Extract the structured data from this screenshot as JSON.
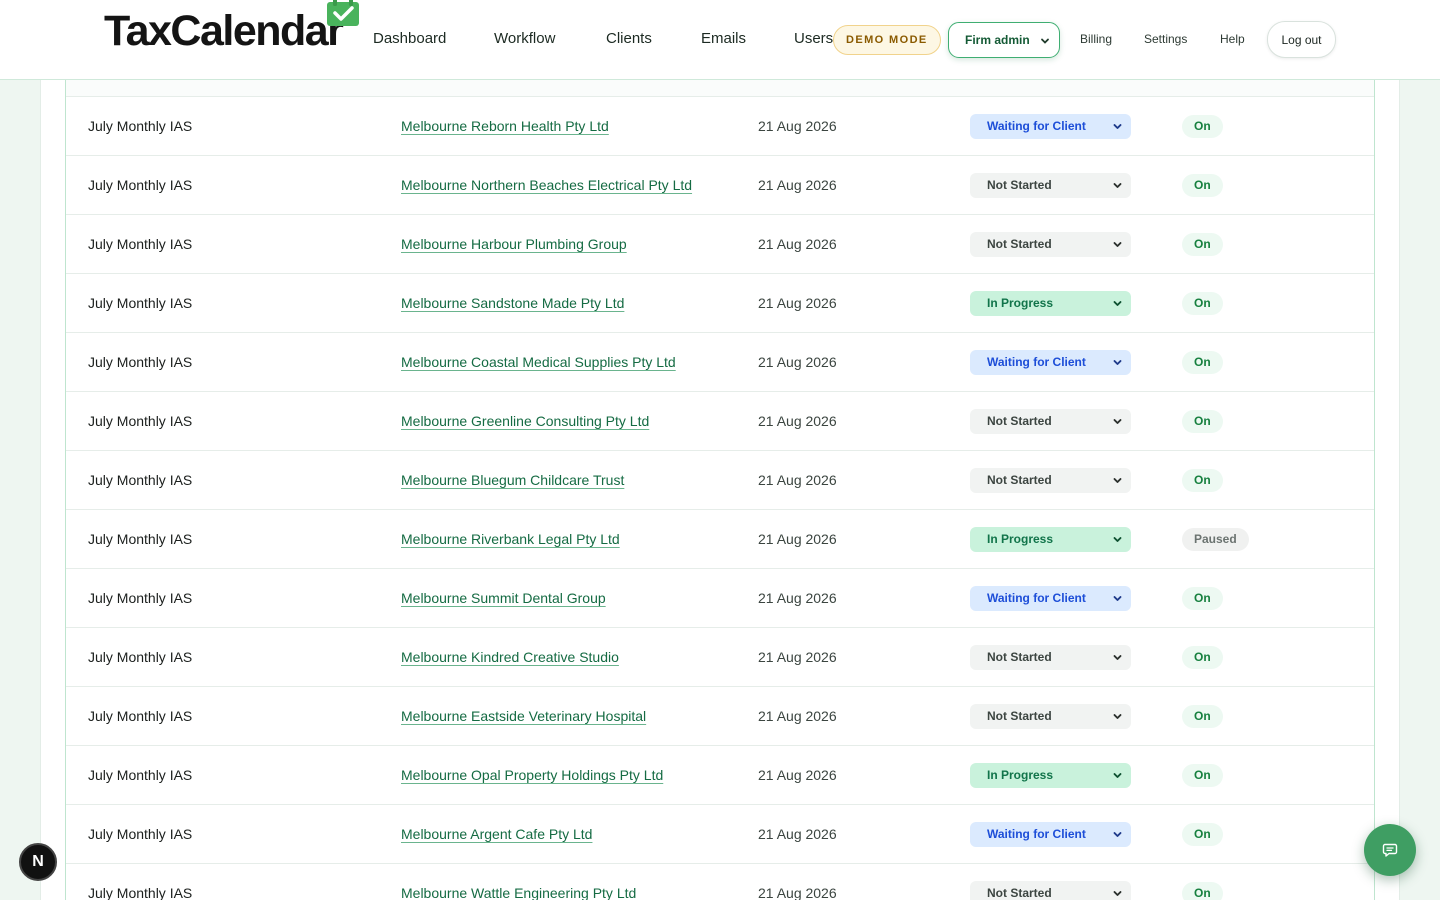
{
  "brand": {
    "logo_text": "TaxCalendar"
  },
  "nav": {
    "links": [
      "Dashboard",
      "Workflow",
      "Clients",
      "Emails",
      "Users"
    ],
    "demo_badge": "DEMO MODE",
    "role_select": "Firm admin",
    "billing": "Billing",
    "settings": "Settings",
    "help": "Help",
    "logout": "Log out"
  },
  "colors": {
    "accent": "#3f9e63",
    "link": "#156b43",
    "status_waiting": "#dbeafe",
    "status_in_progress": "#c9f2dc",
    "status_not_started": "#f1f3f2"
  },
  "rows": [
    {
      "task": "July Monthly IAS",
      "client": "Melbourne Reborn Health Pty Ltd",
      "due": "21 Aug 2026",
      "status": "Waiting for Client",
      "reminders": "On"
    },
    {
      "task": "July Monthly IAS",
      "client": "Melbourne Northern Beaches Electrical Pty Ltd",
      "due": "21 Aug 2026",
      "status": "Not Started",
      "reminders": "On"
    },
    {
      "task": "July Monthly IAS",
      "client": "Melbourne Harbour Plumbing Group",
      "due": "21 Aug 2026",
      "status": "Not Started",
      "reminders": "On"
    },
    {
      "task": "July Monthly IAS",
      "client": "Melbourne Sandstone Made Pty Ltd",
      "due": "21 Aug 2026",
      "status": "In Progress",
      "reminders": "On"
    },
    {
      "task": "July Monthly IAS",
      "client": "Melbourne Coastal Medical Supplies Pty Ltd",
      "due": "21 Aug 2026",
      "status": "Waiting for Client",
      "reminders": "On"
    },
    {
      "task": "July Monthly IAS",
      "client": "Melbourne Greenline Consulting Pty Ltd",
      "due": "21 Aug 2026",
      "status": "Not Started",
      "reminders": "On"
    },
    {
      "task": "July Monthly IAS",
      "client": "Melbourne Bluegum Childcare Trust",
      "due": "21 Aug 2026",
      "status": "Not Started",
      "reminders": "On"
    },
    {
      "task": "July Monthly IAS",
      "client": "Melbourne Riverbank Legal Pty Ltd",
      "due": "21 Aug 2026",
      "status": "In Progress",
      "reminders": "Paused"
    },
    {
      "task": "July Monthly IAS",
      "client": "Melbourne Summit Dental Group",
      "due": "21 Aug 2026",
      "status": "Waiting for Client",
      "reminders": "On"
    },
    {
      "task": "July Monthly IAS",
      "client": "Melbourne Kindred Creative Studio",
      "due": "21 Aug 2026",
      "status": "Not Started",
      "reminders": "On"
    },
    {
      "task": "July Monthly IAS",
      "client": "Melbourne Eastside Veterinary Hospital",
      "due": "21 Aug 2026",
      "status": "Not Started",
      "reminders": "On"
    },
    {
      "task": "July Monthly IAS",
      "client": "Melbourne Opal Property Holdings Pty Ltd",
      "due": "21 Aug 2026",
      "status": "In Progress",
      "reminders": "On"
    },
    {
      "task": "July Monthly IAS",
      "client": "Melbourne Argent Cafe Pty Ltd",
      "due": "21 Aug 2026",
      "status": "Waiting for Client",
      "reminders": "On"
    },
    {
      "task": "July Monthly IAS",
      "client": "Melbourne Wattle Engineering Pty Ltd",
      "due": "21 Aug 2026",
      "status": "Not Started",
      "reminders": "On"
    }
  ],
  "floating": {
    "next_badge": "N",
    "chat_icon": "chat-icon"
  }
}
